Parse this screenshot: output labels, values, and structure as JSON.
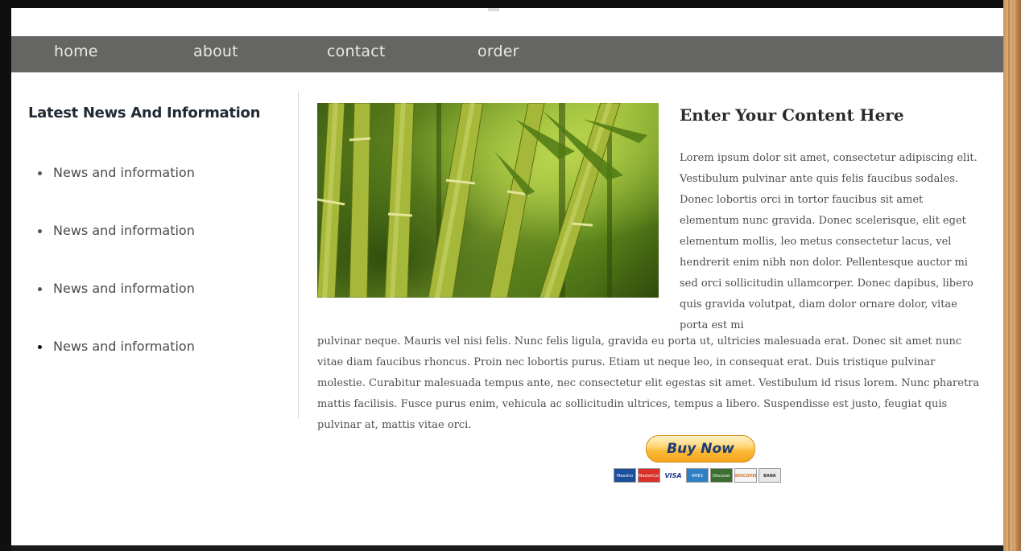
{
  "nav": {
    "items": [
      {
        "label": "home"
      },
      {
        "label": "about"
      },
      {
        "label": "contact"
      },
      {
        "label": "order"
      }
    ],
    "background": "#656663"
  },
  "sidebar": {
    "title": "Latest News And Information",
    "items": [
      {
        "label": "News and information"
      },
      {
        "label": "News and information"
      },
      {
        "label": "News and information"
      },
      {
        "label": "News and information"
      }
    ]
  },
  "main": {
    "image": {
      "icon": "bamboo-photo"
    },
    "title": "Enter Your Content Here",
    "paragraph_narrow": "Lorem ipsum dolor sit amet, consectetur adipiscing elit. Vestibulum pulvinar ante quis felis faucibus sodales. Donec lobortis orci in tortor faucibus sit amet elementum nunc gravida. Donec scelerisque, elit eget elementum mollis, leo metus consectetur lacus, vel hendrerit enim nibh non dolor. Pellentesque auctor mi sed orci sollicitudin ullamcorper. Donec dapibus, libero quis gravida volutpat, diam dolor ornare dolor, vitae porta est mi",
    "paragraph_wide": "pulvinar neque. Mauris vel nisi felis. Nunc felis ligula, gravida eu porta ut, ultricies malesuada erat. Donec sit amet nunc vitae diam faucibus rhoncus. Proin nec lobortis purus. Etiam ut neque leo, in consequat erat. Duis tristique pulvinar molestie. Curabitur malesuada tempus ante, nec consectetur elit egestas sit amet. Vestibulum id risus lorem. Nunc pharetra mattis facilisis. Fusce purus enim, vehicula ac sollicitudin ultrices, tempus a libero. Suspendisse est justo, feugiat quis pulvinar at, mattis vitae orci."
  },
  "paypal": {
    "button_label": "Buy Now",
    "cards": [
      {
        "label": "Maestro",
        "color": "#1b4f9c"
      },
      {
        "label": "MasterCard",
        "color": "#d8312a"
      },
      {
        "label": "VISA",
        "color": "#ffffff"
      },
      {
        "label": "AMEX",
        "color": "#2f7fc4"
      },
      {
        "label": "Discover",
        "color": "#3b6e2f"
      },
      {
        "label": "DISCOVER",
        "color": "#f4f4f4"
      },
      {
        "label": "BANK",
        "color": "#e8e8e8"
      }
    ]
  }
}
